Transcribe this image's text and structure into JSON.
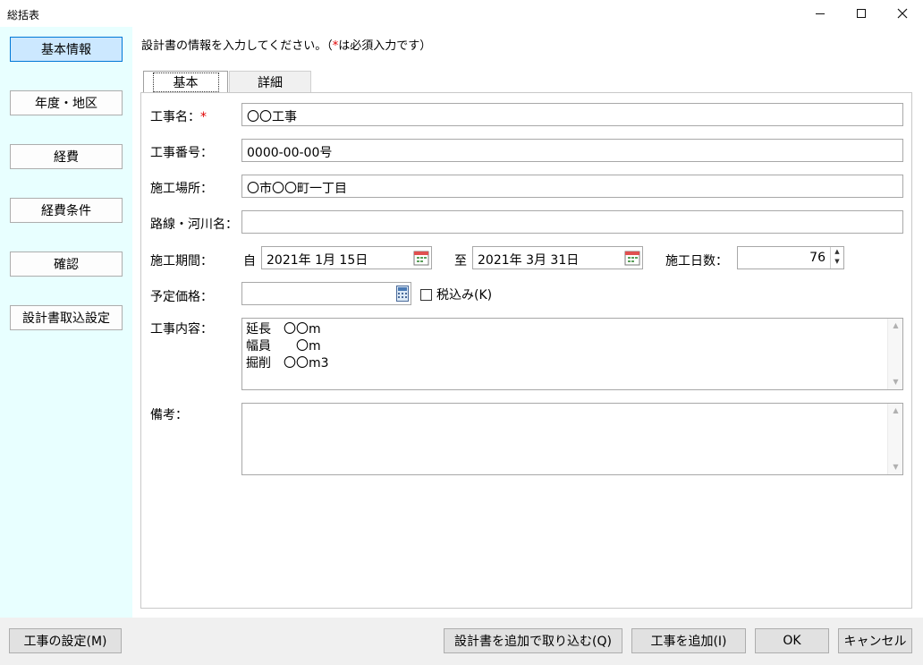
{
  "window": {
    "title": "総括表",
    "minimize_icon": "minimize-icon",
    "maximize_icon": "maximize-icon",
    "close_icon": "close-icon"
  },
  "sidebar": {
    "items": [
      {
        "label": "基本情報",
        "active": true
      },
      {
        "label": "年度・地区",
        "active": false
      },
      {
        "label": "経費",
        "active": false
      },
      {
        "label": "経費条件",
        "active": false
      },
      {
        "label": "確認",
        "active": false
      },
      {
        "label": "設計書取込設定",
        "active": false
      }
    ],
    "background": "#e8ffff",
    "active_color": "#cce8ff"
  },
  "instruction": {
    "prefix": "設計書の情報を入力してください。（",
    "required_mark": "*",
    "suffix": "は必須入力です）"
  },
  "tabs": [
    {
      "label": "基本",
      "selected": true
    },
    {
      "label": "詳細",
      "selected": false
    }
  ],
  "form": {
    "project_name": {
      "label": "工事名：",
      "required_mark": "*",
      "value": "〇〇工事"
    },
    "project_number": {
      "label": "工事番号：",
      "value": "0000-00-00号"
    },
    "site_location": {
      "label": "施工場所：",
      "value": "〇市〇〇町一丁目"
    },
    "route_river": {
      "label": "路線・河川名：",
      "value": ""
    },
    "period": {
      "label": "施工期間：",
      "from_label": "自",
      "from_value": "2021年 1月 15日",
      "to_label": "至",
      "to_value": "2021年 3月 31日",
      "calendar_icon": "calendar-icon",
      "days_label": "施工日数：",
      "days_value": "76"
    },
    "planned_price": {
      "label": "予定価格：",
      "value": "",
      "calculator_icon": "calculator-icon",
      "tax_checkbox_label": "税込み(K)",
      "tax_checked": false
    },
    "work_content": {
      "label": "工事内容：",
      "lines": [
        "延長　〇〇m",
        "幅員　　〇m",
        "掘削　〇〇m3"
      ]
    },
    "remarks": {
      "label": "備考：",
      "value": ""
    }
  },
  "footer": {
    "settings_button": "工事の設定(M)",
    "import_button": "設計書を追加で取り込む(Q)",
    "add_button": "工事を追加(I)",
    "ok_button": "OK",
    "cancel_button": "キャンセル"
  },
  "colors": {
    "required": "#e00000",
    "active_border": "#0078d7"
  }
}
